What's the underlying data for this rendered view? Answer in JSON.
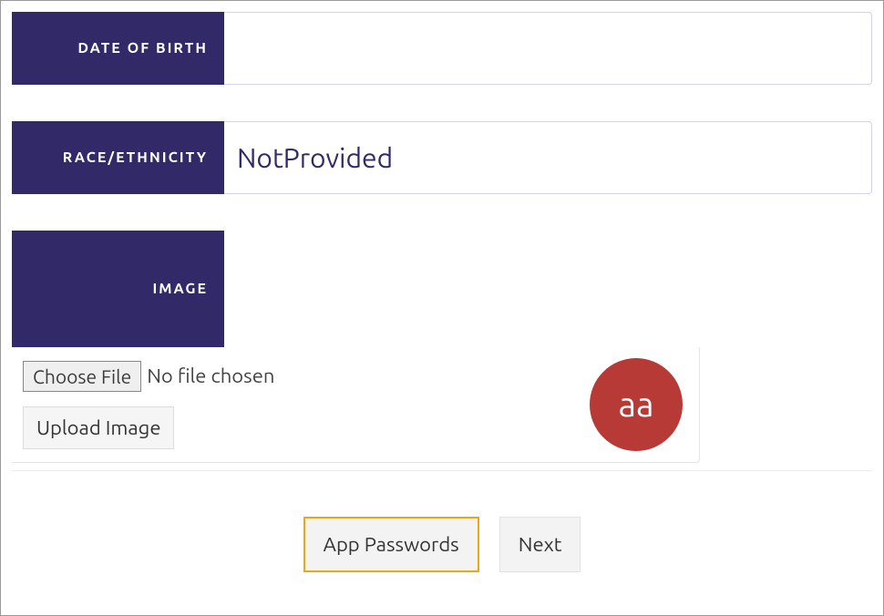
{
  "fields": {
    "dob": {
      "label": "DATE OF BIRTH",
      "value": ""
    },
    "race": {
      "label": "RACE/ETHNICITY",
      "value": "NotProvided"
    },
    "image": {
      "label": "IMAGE"
    }
  },
  "upload": {
    "choose_file_label": "Choose File",
    "no_file_text": "No file chosen",
    "upload_button_label": "Upload Image"
  },
  "avatar": {
    "initials": "aa"
  },
  "buttons": {
    "app_passwords": "App Passwords",
    "next": "Next"
  }
}
